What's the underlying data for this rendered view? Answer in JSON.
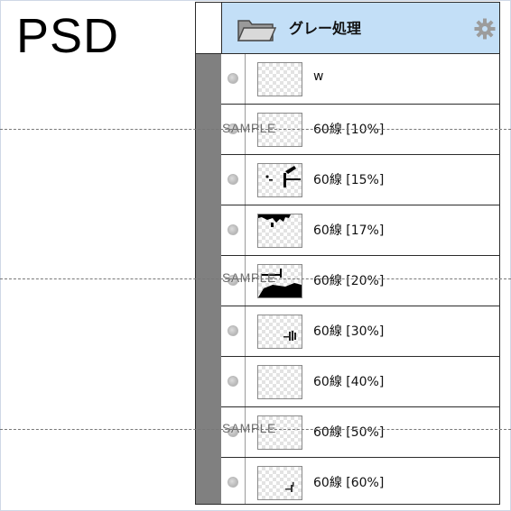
{
  "file_format_label": "PSD",
  "group": {
    "name": "グレー処理",
    "icon": "folder-icon",
    "settings_icon": "gear-icon"
  },
  "layers": [
    {
      "name": "w"
    },
    {
      "name": "60線 [10%]"
    },
    {
      "name": "60線 [15%]"
    },
    {
      "name": "60線 [17%]"
    },
    {
      "name": "60線 [20%]"
    },
    {
      "name": "60線 [30%]"
    },
    {
      "name": "60線 [40%]"
    },
    {
      "name": "60線 [50%]"
    },
    {
      "name": "60線 [60%]"
    }
  ],
  "watermark": {
    "text": "SAMPLE"
  },
  "colors": {
    "group_highlight": "#c3dff7",
    "indent_bar": "#808080"
  }
}
